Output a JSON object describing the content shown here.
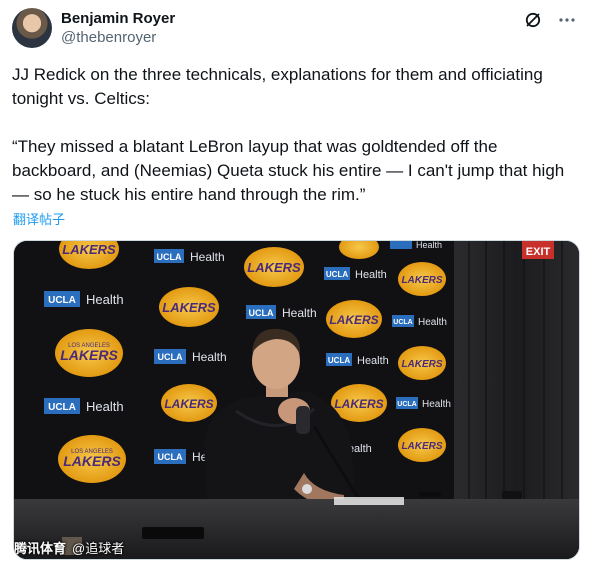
{
  "author": {
    "name": "Benjamin Royer",
    "handle": "@thebenroyer"
  },
  "icons": {
    "grok": "slash-circle-icon",
    "more": "more-icon"
  },
  "tweet": {
    "paragraph1": "JJ Redick on the three technicals, explanations for them and officiating tonight vs. Celtics:",
    "paragraph2": "“They missed a blatant LeBron layup that was goldtended off the backboard, and (Neemias) Queta stuck his entire — I can't jump that high — so he stuck his entire hand through the rim.”",
    "translate_label": "翻译帖子"
  },
  "media": {
    "backdrop_texts": {
      "lakers": "LAKERS",
      "los_angeles": "LOS ANGELES",
      "ucla": "UCLA",
      "health": "Health",
      "exit": "EXIT"
    },
    "watermark_main": "腾讯体育",
    "watermark_sub": "@追球者"
  },
  "colors": {
    "lakers_gold": "#f2b21c",
    "lakers_purple": "#4a2a7a",
    "ucla_blue": "#2a6ebd",
    "link_blue": "#1d9bf0"
  }
}
